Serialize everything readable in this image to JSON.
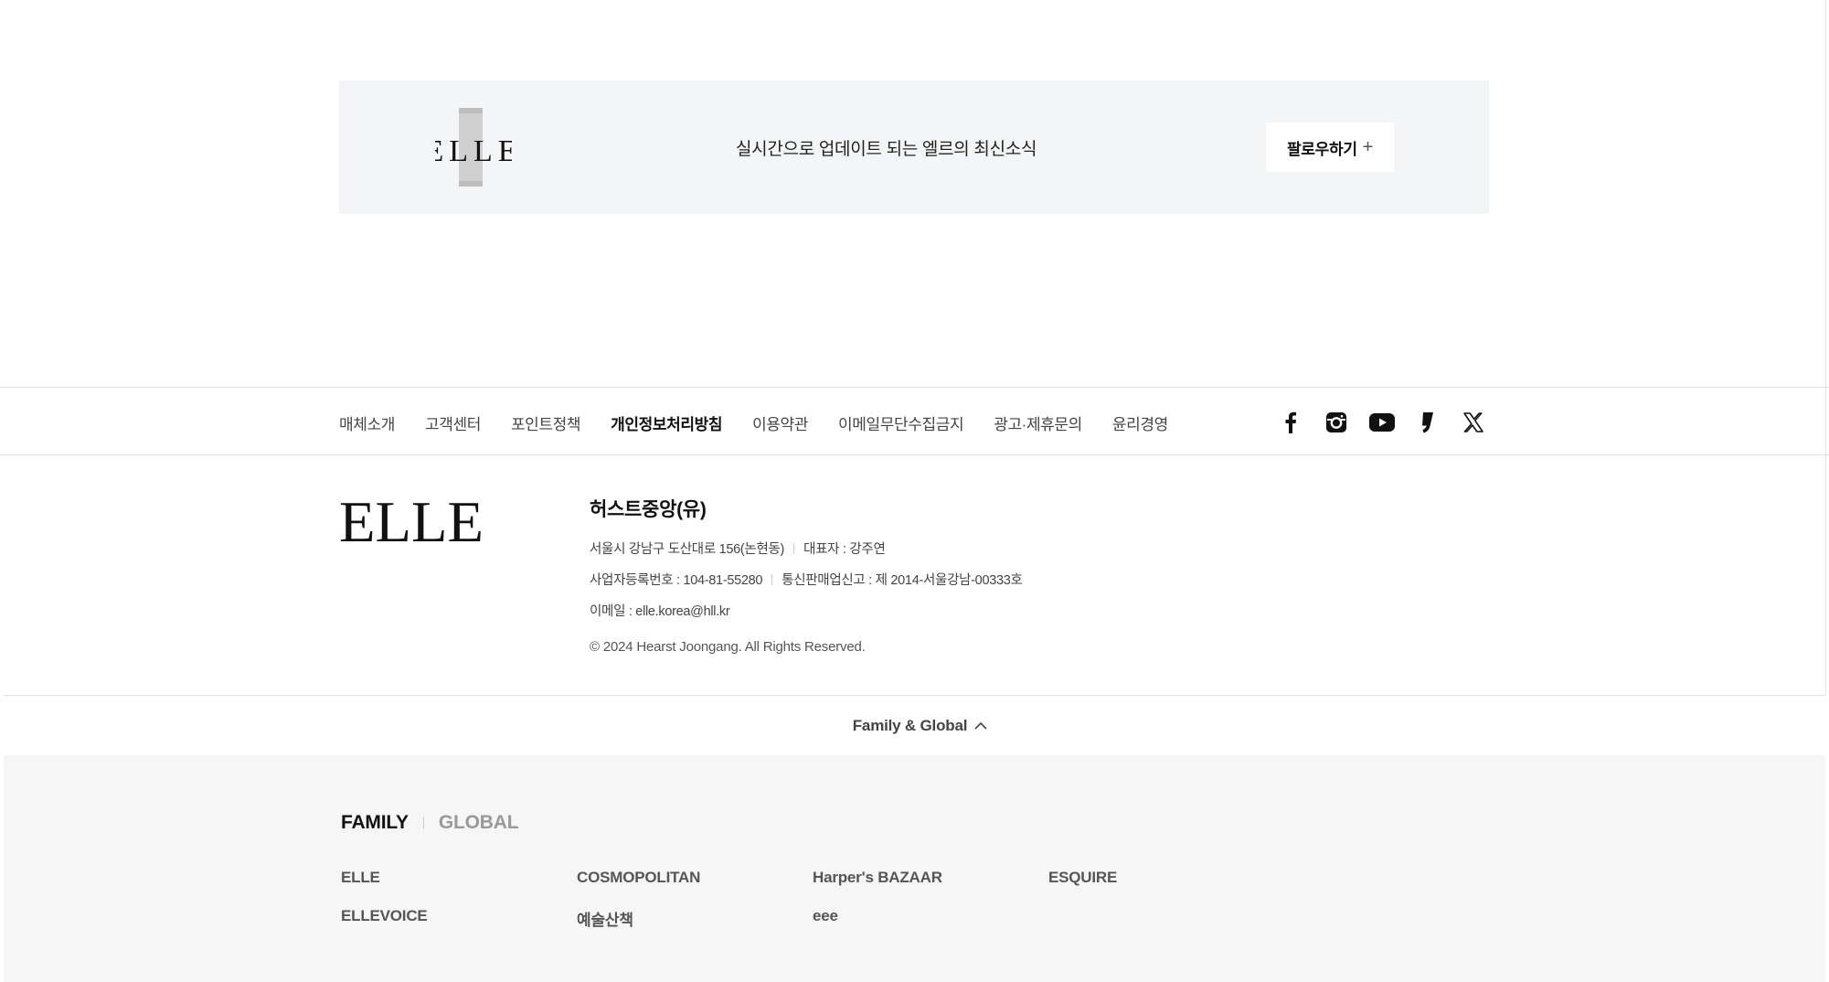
{
  "banner": {
    "logo_text": "ELLE",
    "message": "실시간으로 업데이트 되는 엘르의 최신소식",
    "follow_label": "팔로우하기",
    "follow_icon": "plus-icon"
  },
  "footer_nav": {
    "links": [
      {
        "label": "매체소개"
      },
      {
        "label": "고객센터"
      },
      {
        "label": "포인트정책"
      },
      {
        "label": "개인정보처리방침"
      },
      {
        "label": "이용약관"
      },
      {
        "label": "이메일무단수집금지"
      },
      {
        "label": "광고·제휴문의"
      },
      {
        "label": "윤리경영"
      }
    ],
    "social_icons": [
      "facebook-icon",
      "instagram-icon",
      "youtube-icon",
      "naver-post-icon",
      "x-twitter-icon"
    ]
  },
  "company": {
    "logo_text": "ELLE",
    "name": "허스트중앙(유)",
    "address": "서울시 강남구 도산대로 156(논현동)",
    "ceo": "대표자 : 강주연",
    "business_no": "사업자등록번호 : 104-81-55280",
    "mail_order": "통신판매업신고 : 제 2014-서울강남-00333호",
    "email": "이메일 : elle.korea@hll.kr",
    "copyright": "© 2024 Hearst Joongang. All Rights Reserved."
  },
  "family_global": {
    "toggle_label": "Family & Global",
    "tabs": {
      "family": "FAMILY",
      "global": "GLOBAL"
    },
    "links": [
      {
        "label": "ELLE"
      },
      {
        "label": "COSMOPOLITAN"
      },
      {
        "label": "Harper's BAZAAR"
      },
      {
        "label": "ESQUIRE"
      },
      {
        "label": "ELLEVOICE"
      },
      {
        "label": "예술산책"
      },
      {
        "label": "eee"
      }
    ]
  },
  "colors": {
    "banner_bg": "#f4f5f6",
    "family_bg": "#f6f6f6",
    "text_primary": "#111111",
    "text_muted": "#999999"
  }
}
